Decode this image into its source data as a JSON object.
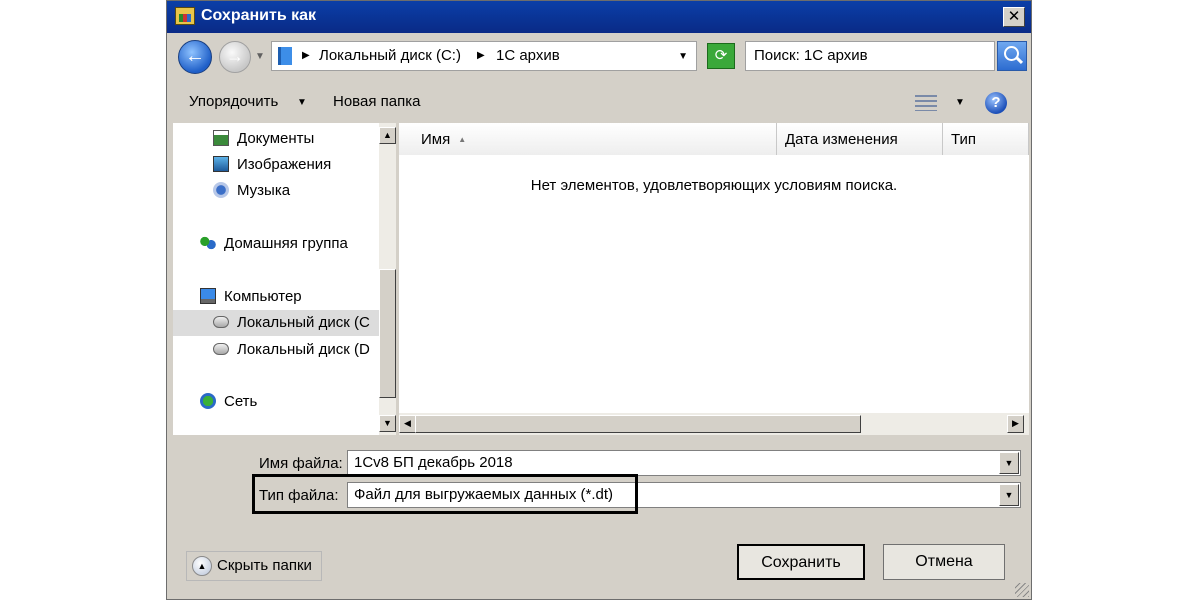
{
  "window": {
    "title": "Сохранить как"
  },
  "navbar": {
    "crumbs": [
      "Локальный диск (C:)",
      "1С архив"
    ],
    "search_placeholder": "Поиск: 1С архив"
  },
  "toolbar": {
    "organize_label": "Упорядочить",
    "new_folder_label": "Новая папка"
  },
  "nav": {
    "items": [
      {
        "label": "Документы",
        "icon": "documents-icon"
      },
      {
        "label": "Изображения",
        "icon": "pictures-icon"
      },
      {
        "label": "Музыка",
        "icon": "music-icon"
      },
      {
        "label": "Домашняя группа",
        "icon": "homegroup-icon"
      },
      {
        "label": "Компьютер",
        "icon": "computer-icon"
      },
      {
        "label": "Локальный диск (C",
        "icon": "drive-icon",
        "selected": true
      },
      {
        "label": "Локальный диск (D",
        "icon": "drive-icon"
      },
      {
        "label": "Сеть",
        "icon": "network-icon"
      }
    ]
  },
  "filelist": {
    "columns": [
      "Имя",
      "Дата изменения",
      "Тип"
    ],
    "empty_message": "Нет элементов, удовлетворяющих условиям поиска."
  },
  "form": {
    "filename_label": "Имя файла:",
    "filename_value": "1Cv8 БП декабрь 2018",
    "filetype_label": "Тип файла:",
    "filetype_value": "Файл для выгружаемых данных (*.dt)"
  },
  "buttons": {
    "hide_folders": "Скрыть папки",
    "save": "Сохранить",
    "cancel": "Отмена"
  }
}
